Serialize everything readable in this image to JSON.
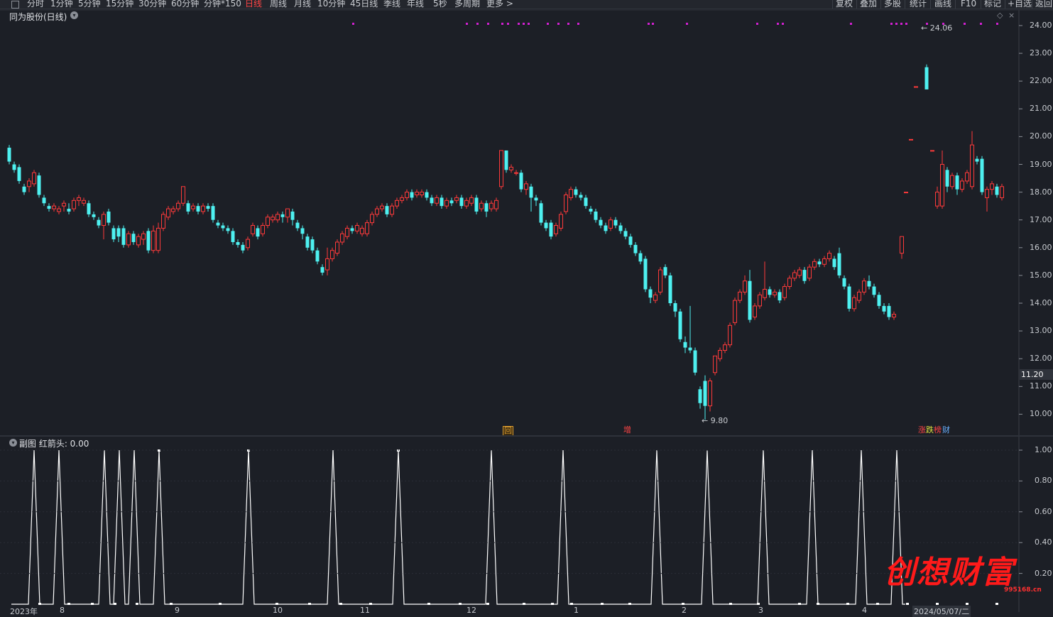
{
  "toolbar": {
    "periods": [
      "分时",
      "1分钟",
      "5分钟",
      "15分钟",
      "30分钟",
      "60分钟",
      "分钟*150",
      "日线",
      "周线",
      "月线",
      "10分钟",
      "45日线",
      "季线",
      "年线",
      "5秒",
      "多周期",
      "更多 >"
    ],
    "active_index": 7,
    "right_buttons": [
      "复权",
      "叠加",
      "多股",
      "统计",
      "画线",
      "F10",
      "标记",
      "+自选",
      "返回"
    ]
  },
  "main_chart": {
    "title": "同为股份(日线)",
    "y_ticks": [
      "24.00",
      "23.00",
      "22.00",
      "21.00",
      "20.00",
      "19.00",
      "18.00",
      "17.00",
      "16.00",
      "15.00",
      "14.00",
      "13.00",
      "12.00",
      "11.00",
      "10.00"
    ],
    "current_price": "11.20",
    "high_label": "24.06",
    "low_label": "9.80",
    "event_tags": [
      {
        "text": "回",
        "color": "#e0a030"
      },
      {
        "text": "增",
        "color": "#ff4545"
      },
      {
        "text": "涨",
        "color": "#ff4545"
      },
      {
        "text": "跌",
        "color": "#e0e040"
      },
      {
        "text": "榜",
        "color": "#ff4545"
      },
      {
        "text": "财",
        "color": "#6ab0ff"
      }
    ]
  },
  "sub_chart": {
    "title": "副图 红箭头: 0.00",
    "y_ticks": [
      "1.00",
      "0.80",
      "0.60",
      "0.40",
      "0.20"
    ],
    "x_labels": [
      "2023年",
      "8",
      "9",
      "10",
      "11",
      "12",
      "1",
      "2",
      "3",
      "4",
      "2024/05/07/二"
    ]
  },
  "colors": {
    "background": "#1c1f26",
    "up": "#ff3a3a",
    "down": "#4ef0f0",
    "magenta": "#d020d0",
    "line": "#ffffff"
  },
  "watermark": {
    "text": "创想财富",
    "url": "995168.cn"
  }
}
